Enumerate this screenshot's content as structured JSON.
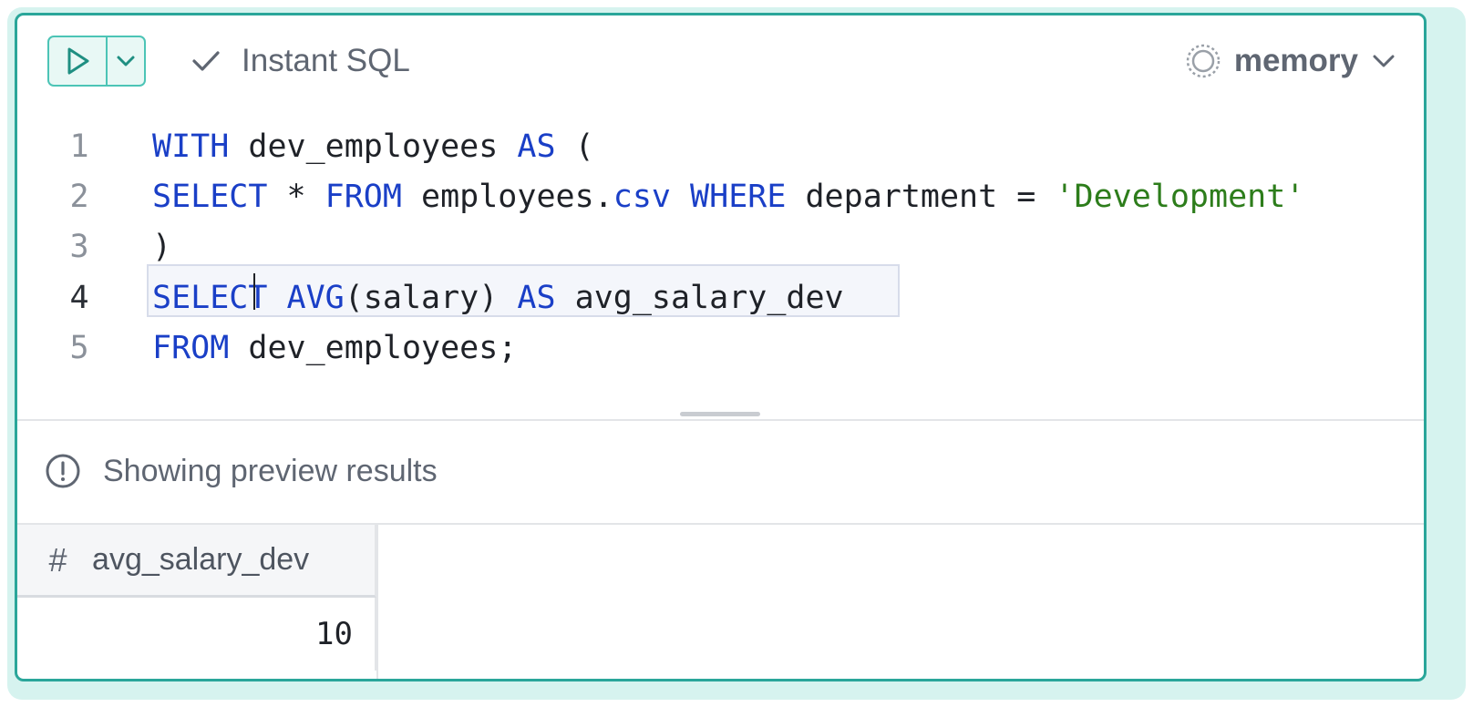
{
  "toolbar": {
    "run_icon": "play-icon",
    "run_menu_icon": "chevron-down-icon",
    "instant_sql_icon": "check-icon",
    "instant_sql_label": "Instant SQL",
    "database_icon": "dashed-circle-icon",
    "database_label": "memory",
    "database_menu_icon": "chevron-down-icon"
  },
  "editor": {
    "lines": [
      {
        "number": "1",
        "text": "WITH dev_employees AS ("
      },
      {
        "number": "2",
        "text": "SELECT * FROM employees.csv WHERE department = 'Development'"
      },
      {
        "number": "3",
        "text": ")"
      },
      {
        "number": "4",
        "text": "SELECT AVG(salary) AS avg_salary_dev"
      },
      {
        "number": "5",
        "text": "FROM dev_employees;"
      }
    ],
    "active_line": 4
  },
  "results": {
    "notice_icon": "alert-circle-icon",
    "notice": "Showing preview results",
    "columns": [
      {
        "type_symbol": "#",
        "name": "avg_salary_dev"
      }
    ],
    "rows": [
      [
        "10"
      ]
    ]
  },
  "colors": {
    "accent": "#2aa69a",
    "keyword": "#1a3fc7",
    "string": "#2d7d1b"
  }
}
